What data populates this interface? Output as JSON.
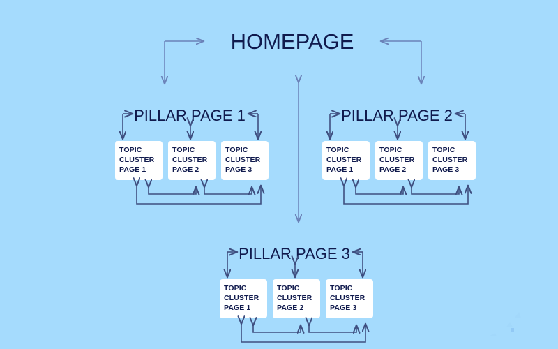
{
  "diagram": {
    "type": "hierarchy-flowchart",
    "title_text": "HOMEPAGE",
    "background_color": "#a5dbfd",
    "text_color": "#101a4d",
    "box_fill_color": "#ffffff",
    "connector_color": "#3f4f80",
    "homepage": {
      "label": "HOMEPAGE"
    },
    "pillars": [
      {
        "id": "pillar-page-1",
        "label": "PILLAR PAGE 1",
        "clusters": [
          {
            "id": "p1-c1",
            "line1": "TOPIC",
            "line2": "CLUSTER",
            "line3": "PAGE 1"
          },
          {
            "id": "p1-c2",
            "line1": "TOPIC",
            "line2": "CLUSTER",
            "line3": "PAGE 2"
          },
          {
            "id": "p1-c3",
            "line1": "TOPIC",
            "line2": "CLUSTER",
            "line3": "PAGE 3"
          }
        ]
      },
      {
        "id": "pillar-page-2",
        "label": "PILLAR PAGE 2",
        "clusters": [
          {
            "id": "p2-c1",
            "line1": "TOPIC",
            "line2": "CLUSTER",
            "line3": "PAGE 1"
          },
          {
            "id": "p2-c2",
            "line1": "TOPIC",
            "line2": "CLUSTER",
            "line3": "PAGE 2"
          },
          {
            "id": "p2-c3",
            "line1": "TOPIC",
            "line2": "CLUSTER",
            "line3": "PAGE 3"
          }
        ]
      },
      {
        "id": "pillar-page-3",
        "label": "PILLAR PAGE 3",
        "clusters": [
          {
            "id": "p3-c1",
            "line1": "TOPIC",
            "line2": "CLUSTER",
            "line3": "PAGE 1"
          },
          {
            "id": "p3-c2",
            "line1": "TOPIC",
            "line2": "CLUSTER",
            "line3": "PAGE 2"
          },
          {
            "id": "p3-c3",
            "line1": "TOPIC",
            "line2": "CLUSTER",
            "line3": "PAGE 3"
          }
        ]
      }
    ]
  }
}
